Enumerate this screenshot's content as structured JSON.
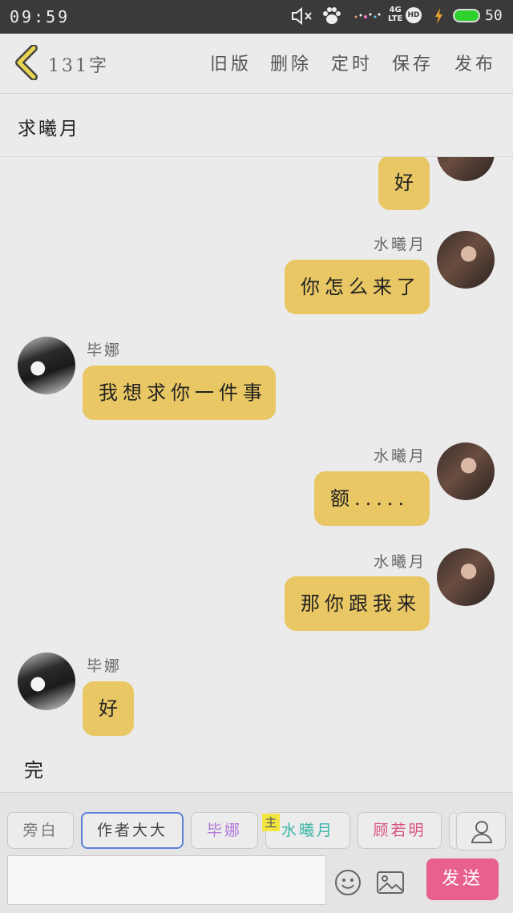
{
  "status_bar": {
    "time": "09:59",
    "network": "4G",
    "network_sub": "LTE",
    "hd": "HD",
    "battery": "50"
  },
  "topbar": {
    "word_count": "131字",
    "actions": [
      "旧版",
      "删除",
      "定时",
      "保存",
      "发布"
    ]
  },
  "story_title": "求曦月",
  "messages": [
    {
      "side": "right",
      "speaker": "",
      "text": "好"
    },
    {
      "side": "right",
      "speaker": "水曦月",
      "text": "你怎么来了"
    },
    {
      "side": "left",
      "speaker": "毕娜",
      "text": "我想求你一件事"
    },
    {
      "side": "right",
      "speaker": "水曦月",
      "text": "额....."
    },
    {
      "side": "right",
      "speaker": "水曦月",
      "text": "那你跟我来"
    },
    {
      "side": "left",
      "speaker": "毕娜",
      "text": "好"
    }
  ],
  "end_text": "完",
  "roles": [
    {
      "label": "旁白",
      "color": "#777777"
    },
    {
      "label": "作者大大",
      "color": "#444444"
    },
    {
      "label": "毕娜",
      "color": "#b07ad8"
    },
    {
      "label": "水曦月",
      "color": "#3cb6a8"
    },
    {
      "label": "顾若明",
      "color": "#d9527d"
    }
  ],
  "main_badge": "主",
  "send_label": "发送",
  "colors": {
    "bubble": "#e9c764",
    "send": "#e8608c",
    "selected_border": "#5b7fd6"
  }
}
